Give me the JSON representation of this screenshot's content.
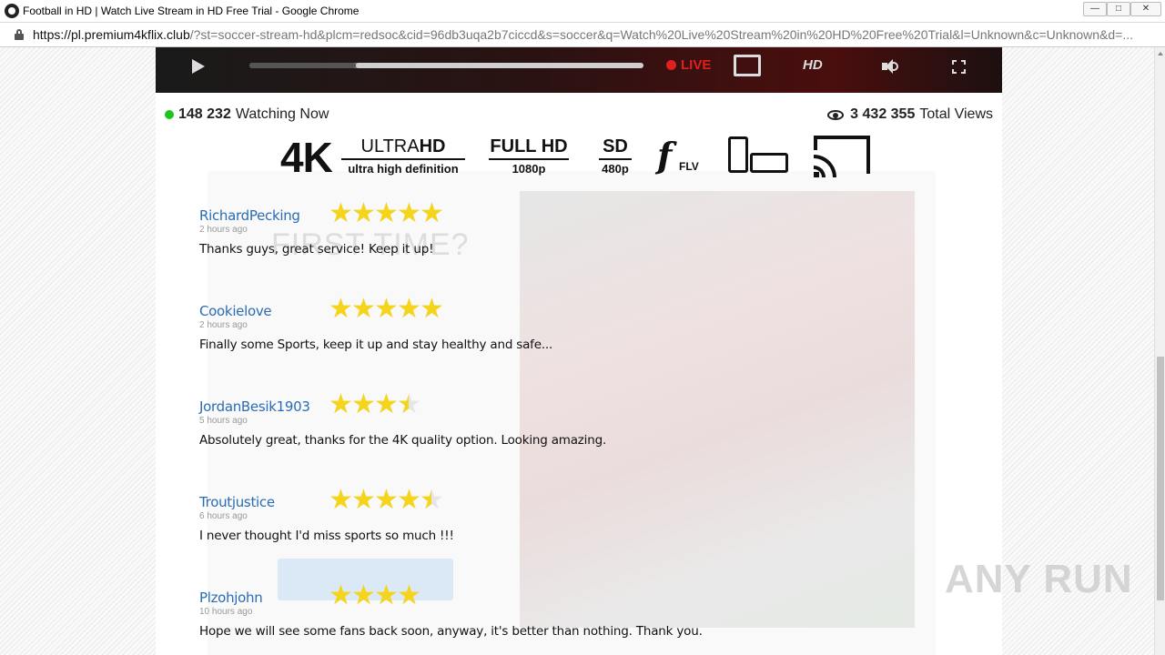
{
  "browser": {
    "title": "Football in HD | Watch Live Stream in HD Free Trial - Google Chrome",
    "url_domain": "https://pl.premium4kflix.club",
    "url_rest": "/?st=soccer-stream-hd&plcm=redsoc&cid=96db3uqa2b7ciccd&s=soccer&q=Watch%20Live%20Stream%20in%20HD%20Free%20Trial&l=Unknown&c=Unknown&d=..."
  },
  "player": {
    "live_label": "LIVE",
    "hd_label": "HD",
    "progress": 0.27,
    "buffer_start": 0.27,
    "buffer_end": 1.0
  },
  "stats": {
    "watching_count": "148 232",
    "watching_label": "Watching Now",
    "views_count": "3 432 355",
    "views_label": "Total Views"
  },
  "badges": {
    "b4k": "4K",
    "ultra_a": "ULTRA",
    "ultra_b": "HD",
    "ultra_sub": "ultra high definition",
    "fullhd": "FULL HD",
    "fullhd_sub": "1080p",
    "sd": "SD",
    "sd_sub": "480p",
    "flv_glyph": "f",
    "flv": "FLV"
  },
  "background_text": "FIRST TIME?",
  "reviews": [
    {
      "name": "RichardPecking",
      "time": "2 hours ago",
      "text": "Thanks guys, great service! Keep it up!",
      "rating": 5
    },
    {
      "name": "Cookielove",
      "time": "2 hours ago",
      "text": "Finally some Sports, keep it up and stay healthy and safe...",
      "rating": 5
    },
    {
      "name": "JordanBesik1903",
      "time": "5 hours ago",
      "text": "Absolutely great, thanks for the 4K quality option. Looking amazing.",
      "rating": 3.5
    },
    {
      "name": "Troutjustice",
      "time": "6 hours ago",
      "text": "I never thought I'd miss sports so much !!!",
      "rating": 4.5
    },
    {
      "name": "Plzohjohn",
      "time": "10 hours ago",
      "text": "Hope we will see some fans back soon, anyway, it's better than nothing. Thank you.",
      "rating": 4
    }
  ],
  "watermark": "ANY RUN",
  "colors": {
    "live": "#e0201c",
    "star": "#f5d51b",
    "link": "#2a6cb5",
    "online": "#1ec31e"
  }
}
